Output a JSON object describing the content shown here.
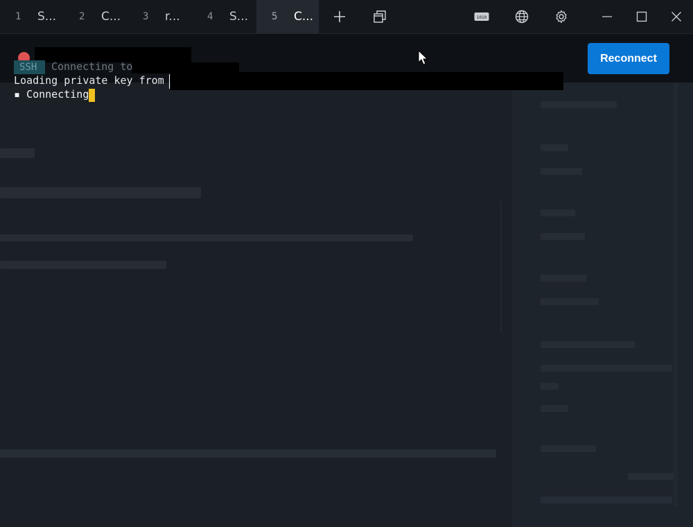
{
  "tabs": [
    {
      "num": "1",
      "title": "S..."
    },
    {
      "num": "2",
      "title": "C..."
    },
    {
      "num": "3",
      "title": "r..."
    },
    {
      "num": "4",
      "title": "S..."
    },
    {
      "num": "5",
      "title": "C..."
    }
  ],
  "active_tab_index": 4,
  "toolbar": {
    "new_tab_icon": "plus-icon",
    "window_list_icon": "windows-stack-icon",
    "binary_icon": "binary-keyboard-icon",
    "globe_icon": "globe-icon",
    "settings_icon": "gear-icon",
    "minimize_icon": "minimize-icon",
    "maximize_icon": "maximize-icon",
    "close_icon": "close-icon"
  },
  "header": {
    "reconnect_label": "Reconnect",
    "status_color": "#e05353"
  },
  "terminal": {
    "badge": "SSH",
    "connecting_to": "Connecting to",
    "loading_line": "Loading private key from",
    "bullet_line": "▪ Connecting",
    "cursor_color": "#f0c020"
  },
  "colors": {
    "accent": "#0a78d7",
    "background": "#1b2027",
    "tabbar": "#15191e"
  }
}
